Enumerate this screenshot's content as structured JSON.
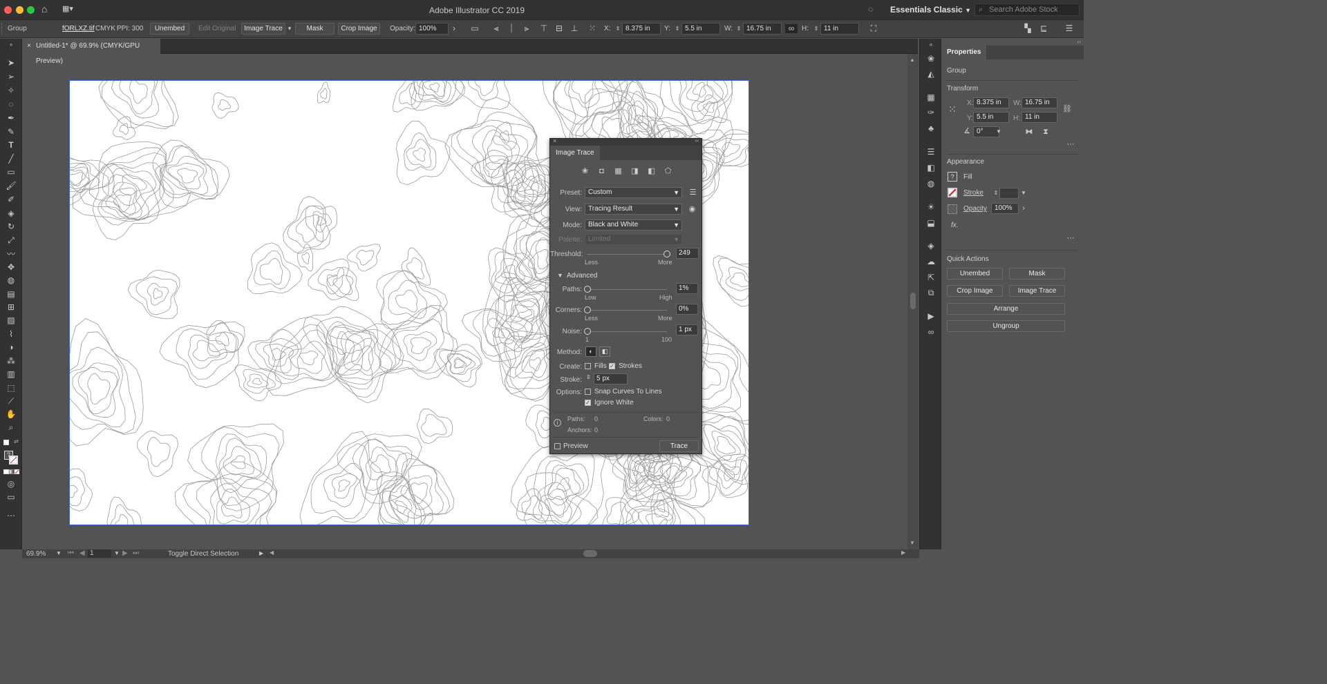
{
  "titlebar": {
    "app_title": "Adobe Illustrator CC 2019",
    "workspace": "Essentials Classic",
    "search_placeholder": "Search Adobe Stock"
  },
  "controlbar": {
    "selection_type": "Group",
    "file_name": "fORLXZ.tif",
    "color_mode": "CMYK",
    "ppi": "PPI: 300",
    "unembed": "Unembed",
    "edit_original": "Edit Original",
    "image_trace": "Image Trace",
    "mask": "Mask",
    "crop_image": "Crop Image",
    "opacity_label": "Opacity:",
    "opacity_value": "100%",
    "x_label": "X:",
    "x_value": "8.375 in",
    "y_label": "Y:",
    "y_value": "5.5 in",
    "w_label": "W:",
    "w_value": "16.75 in",
    "h_label": "H:",
    "h_value": "11 in"
  },
  "document": {
    "tab_title": "Untitled-1* @ 69.9% (CMYK/GPU Preview)"
  },
  "image_trace_panel": {
    "title": "Image Trace",
    "preset_label": "Preset:",
    "preset_value": "Custom",
    "view_label": "View:",
    "view_value": "Tracing Result",
    "mode_label": "Mode:",
    "mode_value": "Black and White",
    "palette_label": "Palette:",
    "palette_value": "Limited",
    "threshold_label": "Threshold:",
    "threshold_value": "249",
    "threshold_min": "Less",
    "threshold_max": "More",
    "threshold_fraction": 0.99,
    "advanced_label": "Advanced",
    "paths_label": "Paths:",
    "paths_value": "1%",
    "paths_min": "Low",
    "paths_max": "High",
    "corners_label": "Corners:",
    "corners_value": "0%",
    "corners_min": "Less",
    "corners_max": "More",
    "noise_label": "Noise:",
    "noise_value": "1 px",
    "noise_min": "1",
    "noise_max": "100",
    "method_label": "Method:",
    "create_label": "Create:",
    "fills_label": "Fills",
    "fills_checked": false,
    "strokes_label": "Strokes",
    "strokes_checked": true,
    "stroke_label": "Stroke:",
    "stroke_value": "5 px",
    "options_label": "Options:",
    "snap_label": "Snap Curves To Lines",
    "snap_checked": false,
    "ignore_white_label": "Ignore White",
    "ignore_white_checked": true,
    "info_paths_label": "Paths:",
    "info_paths_value": "0",
    "info_colors_label": "Colors:",
    "info_colors_value": "0",
    "info_anchors_label": "Anchors:",
    "info_anchors_value": "0",
    "preview_label": "Preview",
    "preview_checked": false,
    "trace_button": "Trace"
  },
  "properties_panel": {
    "title": "Properties",
    "selection_type": "Group",
    "transform_label": "Transform",
    "x_label": "X:",
    "x_value": "8.375 in",
    "y_label": "Y:",
    "y_value": "5.5 in",
    "w_label": "W:",
    "w_value": "16.75 in",
    "h_label": "H:",
    "h_value": "11 in",
    "rotate_value": "0°",
    "appearance_label": "Appearance",
    "fill_label": "Fill",
    "stroke_label": "Stroke",
    "opacity_label": "Opacity",
    "opacity_value": "100%",
    "fx_label": "fx.",
    "quick_actions_label": "Quick Actions",
    "qa_unembed": "Unembed",
    "qa_mask": "Mask",
    "qa_crop_image": "Crop Image",
    "qa_image_trace": "Image Trace",
    "qa_arrange": "Arrange",
    "qa_ungroup": "Ungroup"
  },
  "statusbar": {
    "zoom": "69.9%",
    "artboard_number": "1",
    "status_text": "Toggle Direct Selection"
  },
  "colors": {
    "accent_blue": "#3a5fcd",
    "close_red": "#ff5f57",
    "min_yellow": "#febc2e",
    "max_green": "#28c840"
  }
}
